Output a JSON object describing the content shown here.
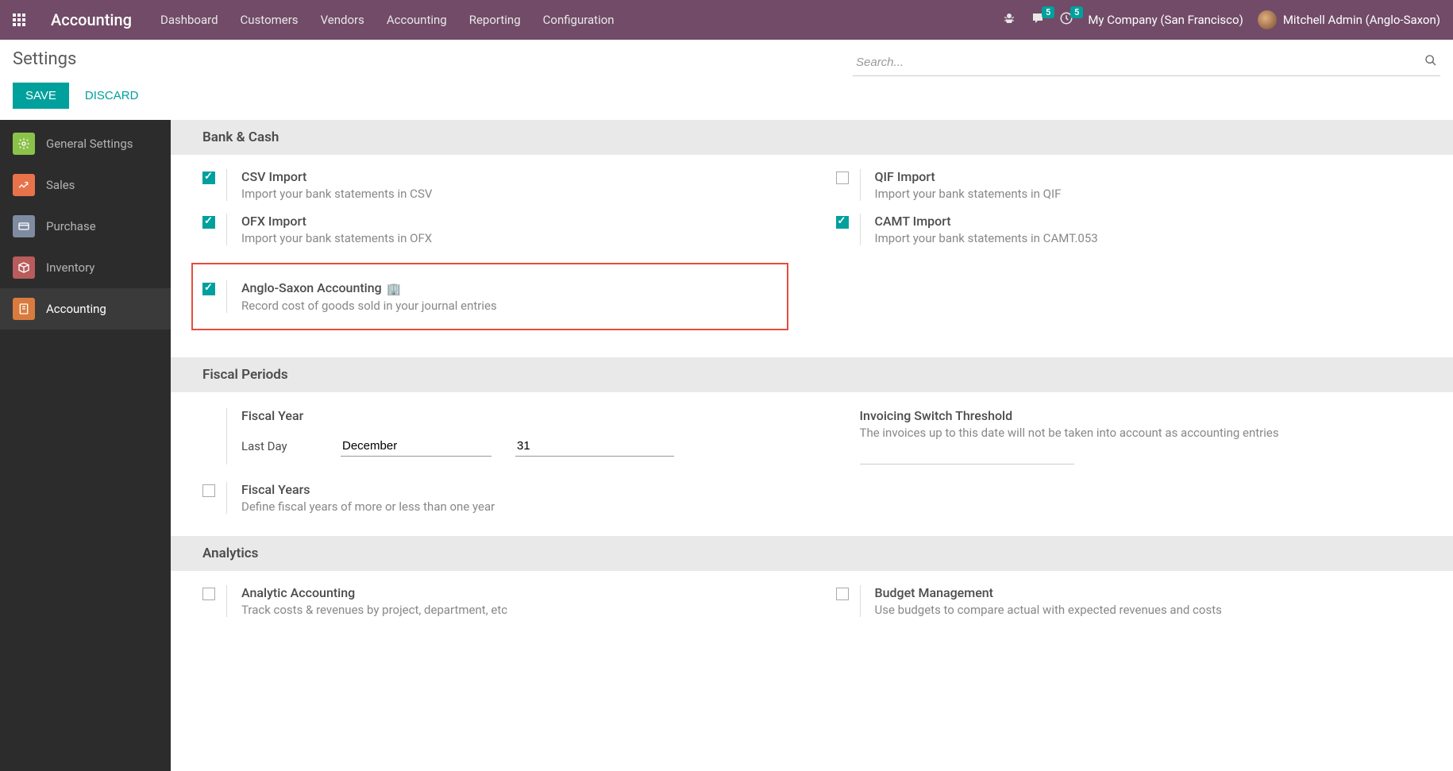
{
  "navbar": {
    "app_name": "Accounting",
    "menu": [
      "Dashboard",
      "Customers",
      "Vendors",
      "Accounting",
      "Reporting",
      "Configuration"
    ],
    "messages_badge": "5",
    "activities_badge": "5",
    "company": "My Company (San Francisco)",
    "user": "Mitchell Admin (Anglo-Saxon)"
  },
  "page": {
    "title": "Settings",
    "search_placeholder": "Search...",
    "save": "SAVE",
    "discard": "DISCARD"
  },
  "sidebar": {
    "items": [
      {
        "label": "General Settings"
      },
      {
        "label": "Sales"
      },
      {
        "label": "Purchase"
      },
      {
        "label": "Inventory"
      },
      {
        "label": "Accounting"
      }
    ]
  },
  "sections": {
    "bank_cash": {
      "title": "Bank & Cash",
      "csv_import": {
        "title": "CSV Import",
        "desc": "Import your bank statements in CSV"
      },
      "qif_import": {
        "title": "QIF Import",
        "desc": "Import your bank statements in QIF"
      },
      "ofx_import": {
        "title": "OFX Import",
        "desc": "Import your bank statements in OFX"
      },
      "camt_import": {
        "title": "CAMT Import",
        "desc": "Import your bank statements in CAMT.053"
      },
      "anglo": {
        "title": "Anglo-Saxon Accounting",
        "desc": "Record cost of goods sold in your journal entries"
      }
    },
    "fiscal": {
      "title": "Fiscal Periods",
      "fiscal_year_label": "Fiscal Year",
      "last_day_label": "Last Day",
      "month_value": "December",
      "day_value": "31",
      "fiscal_years": {
        "title": "Fiscal Years",
        "desc": "Define fiscal years of more or less than one year"
      },
      "threshold": {
        "title": "Invoicing Switch Threshold",
        "desc": "The invoices up to this date will not be taken into account as accounting entries"
      }
    },
    "analytics": {
      "title": "Analytics",
      "analytic": {
        "title": "Analytic Accounting",
        "desc": "Track costs & revenues by project, department, etc"
      },
      "budget": {
        "title": "Budget Management",
        "desc": "Use budgets to compare actual with expected revenues and costs"
      }
    }
  }
}
